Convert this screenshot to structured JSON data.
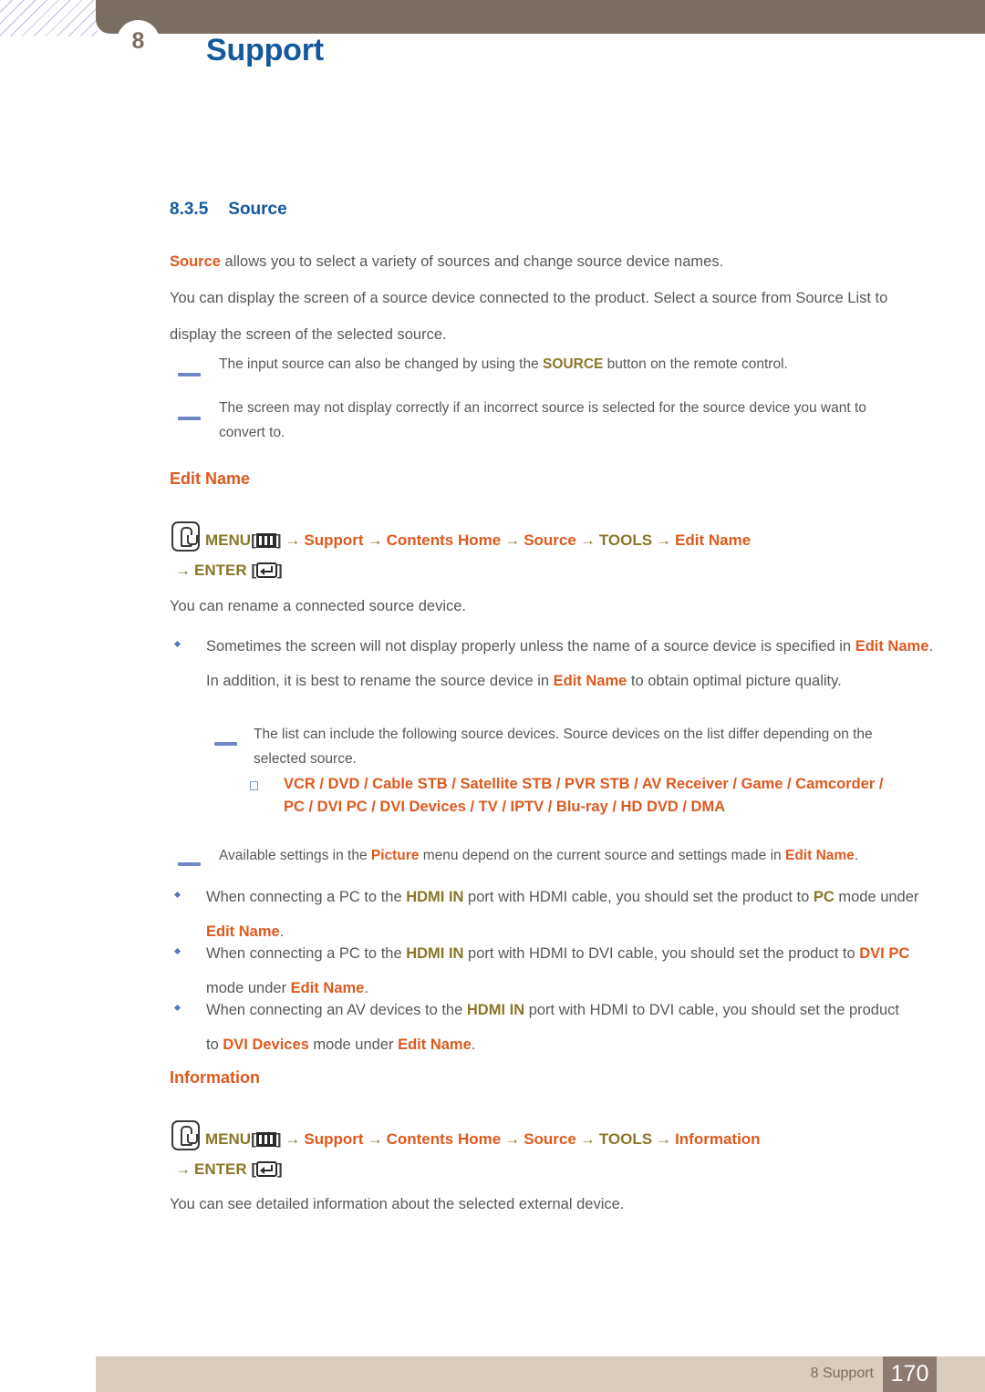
{
  "header": {
    "chapter_number": "8",
    "title": "Support"
  },
  "section": {
    "number": "8.3.5",
    "title": "Source",
    "intro_term": "Source",
    "intro_rest": " allows you to select a variety of sources and change source device names.",
    "paragraph2": "You can display the screen of a source device connected to the product. Select a source from Source List to display the screen of the selected source."
  },
  "top_notes": [
    {
      "pre": "The input source can also be changed by using the ",
      "term": "SOURCE",
      "post": " button on the remote control."
    },
    {
      "pre": "The screen may not display correctly if an incorrect source is selected for the source device you want to convert to.",
      "term": "",
      "post": ""
    }
  ],
  "edit_name": {
    "heading": "Edit Name",
    "menu_path": {
      "menu_label": "MENU",
      "enter_label": "ENTER",
      "steps": [
        "Support",
        "Contents Home",
        "Source",
        "TOOLS",
        "Edit Name"
      ],
      "arrow": "→",
      "bracket_open": "[",
      "bracket_close": "]"
    },
    "description": "You can rename a connected source device.",
    "bullet1": {
      "p1": "Sometimes the screen will not display properly unless the name of a source device is specified in ",
      "t1": "Edit Name",
      "p2": ". In addition, it is best to rename the source device in ",
      "t2": "Edit Name",
      "p3": " to obtain optimal picture quality."
    },
    "note_list_intro": "The list can include the following source devices. Source devices on the list differ depending on the selected source.",
    "source_devices_line1": "VCR / DVD / Cable STB / Satellite STB / PVR STB / AV Receiver / Game / Camcorder /",
    "source_devices_line2": "PC / DVI PC / DVI Devices / TV / IPTV / Blu-ray / HD DVD / DMA",
    "note_picture": {
      "p1": "Available settings in the ",
      "t1": "Picture",
      "p2": " menu depend on the current source and settings made in ",
      "t2": "Edit Name",
      "p3": "."
    },
    "bullet_pc": {
      "p1": "When connecting a PC to the ",
      "t1": "HDMI IN",
      "p2": " port with HDMI cable, you should set the product to ",
      "t2": "PC",
      "p3": " mode under ",
      "t3": "Edit Name",
      "p4": "."
    },
    "bullet_dvipc": {
      "p1": "When connecting a PC to the ",
      "t1": "HDMI IN",
      "p2": " port with HDMI to DVI cable, you should set the product to ",
      "t2": "DVI PC",
      "p3": " mode under ",
      "t3": "Edit Name",
      "p4": "."
    },
    "bullet_dvidev": {
      "p1": "When connecting an AV devices to the ",
      "t1": "HDMI IN",
      "p2": " port with HDMI to DVI cable, you should set the product to ",
      "t2": "DVI Devices",
      "p3": " mode under ",
      "t3": "Edit Name",
      "p4": "."
    }
  },
  "information": {
    "heading": "Information",
    "menu_path": {
      "menu_label": "MENU",
      "enter_label": "ENTER",
      "steps": [
        "Support",
        "Contents Home",
        "Source",
        "TOOLS",
        "Information"
      ],
      "arrow": "→",
      "bracket_open": "[",
      "bracket_close": "]"
    },
    "description": "You can see detailed information about the selected external device."
  },
  "footer": {
    "label": "8 Support",
    "page_number": "170"
  },
  "colors": {
    "heading_blue": "#14599f",
    "accent_orange": "#dd5a1f",
    "accent_gold": "#8a7729",
    "header_brown": "#7b6e62",
    "footer_beige": "#d8cdbc",
    "footer_page_brown": "#8d7a70",
    "body_gray": "#58585a"
  }
}
